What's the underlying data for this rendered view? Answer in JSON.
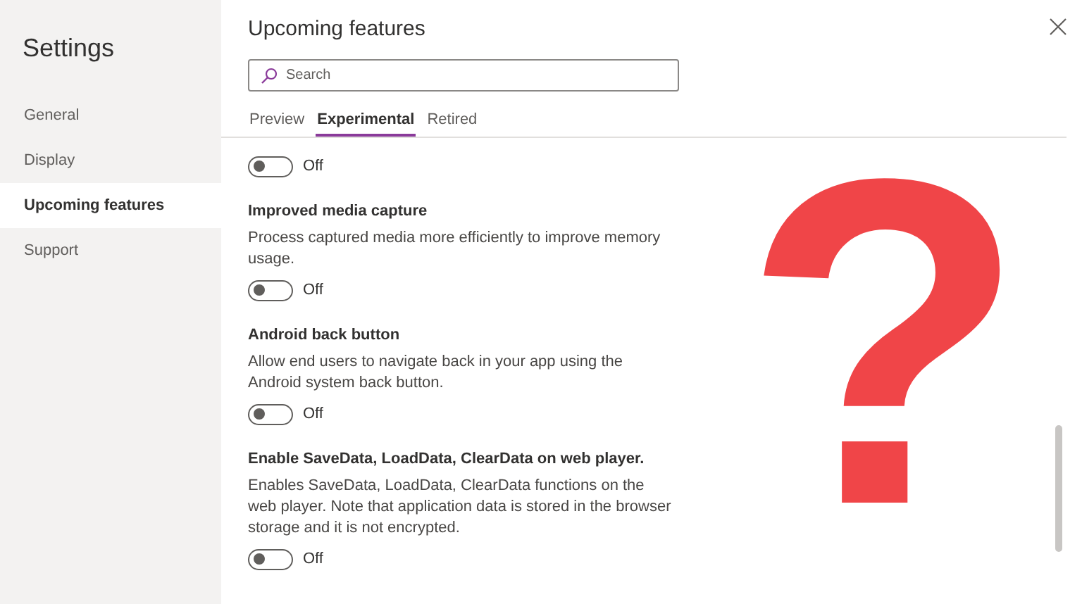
{
  "sidebar": {
    "title": "Settings",
    "items": [
      {
        "label": "General",
        "selected": false
      },
      {
        "label": "Display",
        "selected": false
      },
      {
        "label": "Upcoming features",
        "selected": true
      },
      {
        "label": "Support",
        "selected": false
      }
    ]
  },
  "panel": {
    "title": "Upcoming features",
    "search": {
      "placeholder": "Search"
    },
    "tabs": [
      {
        "label": "Preview",
        "selected": false
      },
      {
        "label": "Experimental",
        "selected": true
      },
      {
        "label": "Retired",
        "selected": false
      }
    ],
    "features": [
      {
        "on": false,
        "status": "Off"
      },
      {
        "title": "Improved media capture",
        "description": "Process captured media more efficiently to improve memory usage.",
        "on": false,
        "status": "Off"
      },
      {
        "title": "Android back button",
        "description": "Allow end users to navigate back in your app using the Android system back button.",
        "on": false,
        "status": "Off"
      },
      {
        "title": "Enable SaveData, LoadData, ClearData on web player.",
        "description": "Enables SaveData, LoadData, ClearData functions on the web player. Note that application data is stored in the browser storage and it is not encrypted.",
        "on": false,
        "status": "Off"
      }
    ]
  },
  "overlay_mark": "?"
}
